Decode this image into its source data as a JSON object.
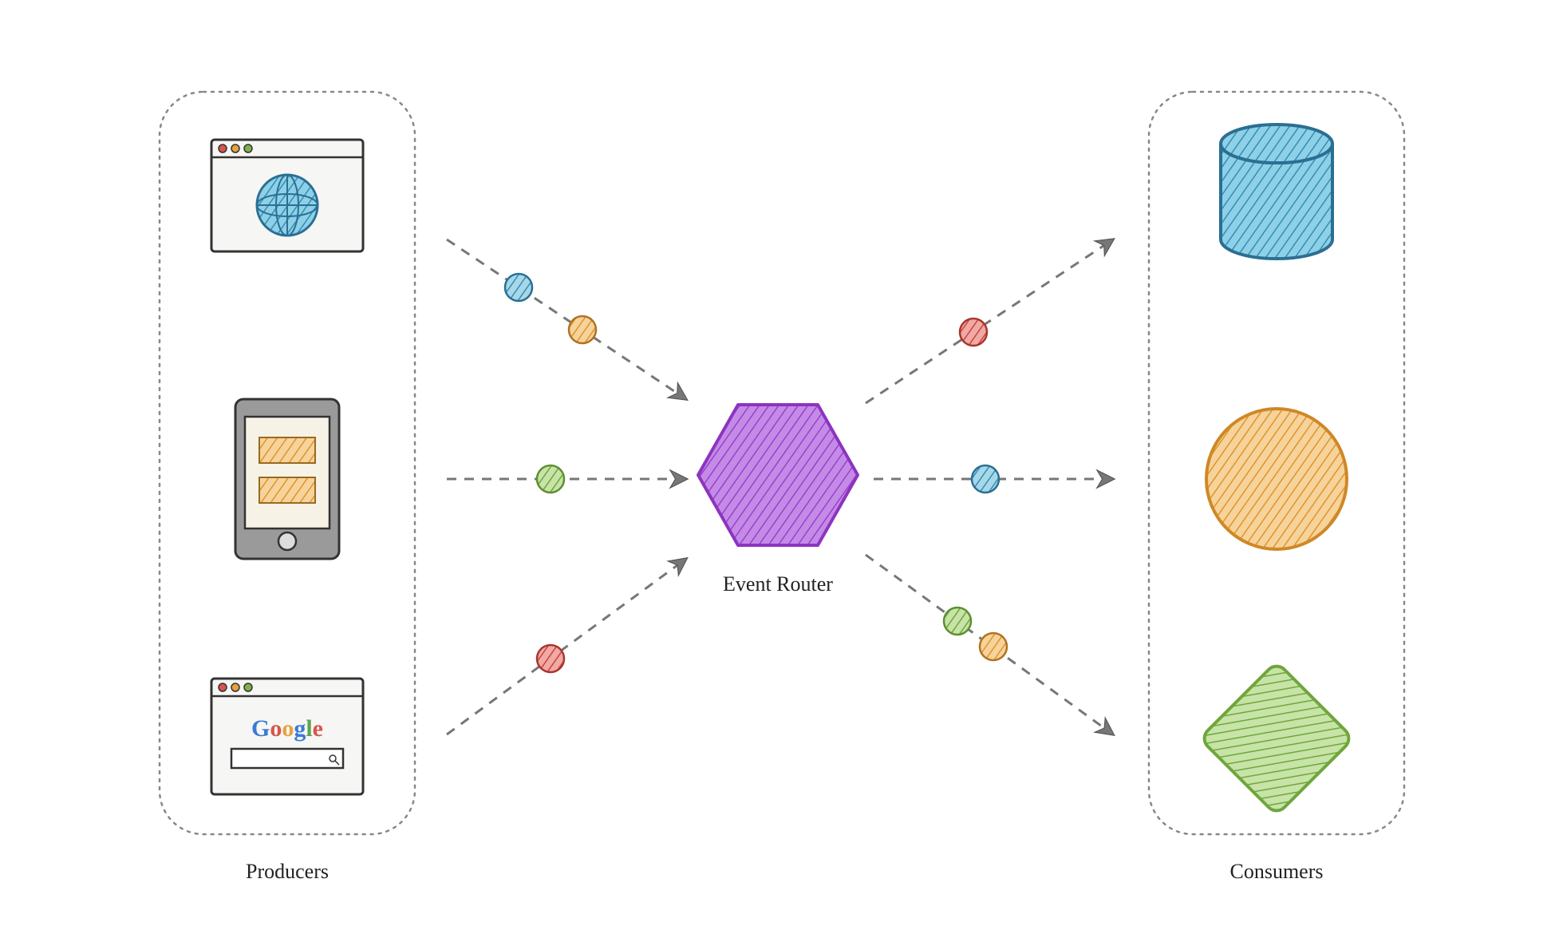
{
  "labels": {
    "producers": "Producers",
    "consumers": "Consumers",
    "router": "Event Router",
    "google": "Google"
  },
  "producers": [
    {
      "kind": "browser-globe"
    },
    {
      "kind": "mobile-device"
    },
    {
      "kind": "browser-google"
    }
  ],
  "consumers": [
    {
      "kind": "cylinder",
      "color": "#3a9ec4"
    },
    {
      "kind": "circle",
      "color": "#e9a23b"
    },
    {
      "kind": "diamond",
      "color": "#7fb24a"
    }
  ],
  "arrows": {
    "in": [
      {
        "dots": [
          {
            "color": "#3a9ec4"
          },
          {
            "color": "#e9a23b"
          }
        ]
      },
      {
        "dots": [
          {
            "color": "#7fb24a"
          }
        ]
      },
      {
        "dots": [
          {
            "color": "#d9544d"
          }
        ]
      }
    ],
    "out": [
      {
        "dots": [
          {
            "color": "#d9544d"
          }
        ]
      },
      {
        "dots": [
          {
            "color": "#3a9ec4"
          }
        ]
      },
      {
        "dots": [
          {
            "color": "#7fb24a"
          },
          {
            "color": "#e9a23b"
          }
        ]
      }
    ]
  },
  "router": {
    "color": "#a64dd6"
  },
  "colors": {
    "dash": "#777",
    "dot_border": "#555",
    "panel_border": "#888"
  }
}
